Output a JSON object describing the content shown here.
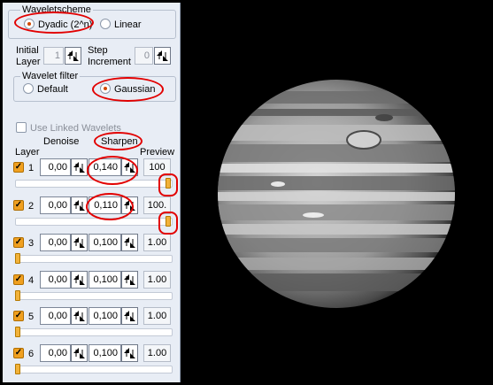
{
  "wavelet_scheme": {
    "title": "Waveletscheme",
    "options": [
      {
        "label": "Dyadic (2^n)",
        "selected": true
      },
      {
        "label": "Linear",
        "selected": false
      }
    ]
  },
  "initial_layer": {
    "label_line1": "Initial",
    "label_line2": "Layer",
    "value": "1"
  },
  "step_increment": {
    "label_line1": "Step",
    "label_line2": "Increment",
    "value": "0"
  },
  "wavelet_filter": {
    "title": "Wavelet filter",
    "options": [
      {
        "label": "Default",
        "selected": false
      },
      {
        "label": "Gaussian",
        "selected": true
      }
    ]
  },
  "use_linked_wavelets": {
    "label": "Use Linked Wavelets",
    "checked": false
  },
  "columns": {
    "layer": "Layer",
    "denoise": "Denoise",
    "sharpen": "Sharpen",
    "preview": "Preview"
  },
  "layers": [
    {
      "number": "1",
      "checked": true,
      "denoise": "0,00",
      "sharpen": "0,140",
      "preview": "100",
      "slider_fraction": 1.0
    },
    {
      "number": "2",
      "checked": true,
      "denoise": "0,00",
      "sharpen": "0,110",
      "preview": "100.",
      "slider_fraction": 1.0
    },
    {
      "number": "3",
      "checked": true,
      "denoise": "0,00",
      "sharpen": "0,100",
      "preview": "1.00",
      "slider_fraction": 0.0
    },
    {
      "number": "4",
      "checked": true,
      "denoise": "0,00",
      "sharpen": "0,100",
      "preview": "1.00",
      "slider_fraction": 0.0
    },
    {
      "number": "5",
      "checked": true,
      "denoise": "0,00",
      "sharpen": "0,100",
      "preview": "1.00",
      "slider_fraction": 0.0
    },
    {
      "number": "6",
      "checked": true,
      "denoise": "0,00",
      "sharpen": "0,100",
      "preview": "1.00",
      "slider_fraction": 0.0
    }
  ],
  "colors": {
    "accent": "#f0a020",
    "highlight": "#e20000",
    "panel": "#e8edf5"
  }
}
